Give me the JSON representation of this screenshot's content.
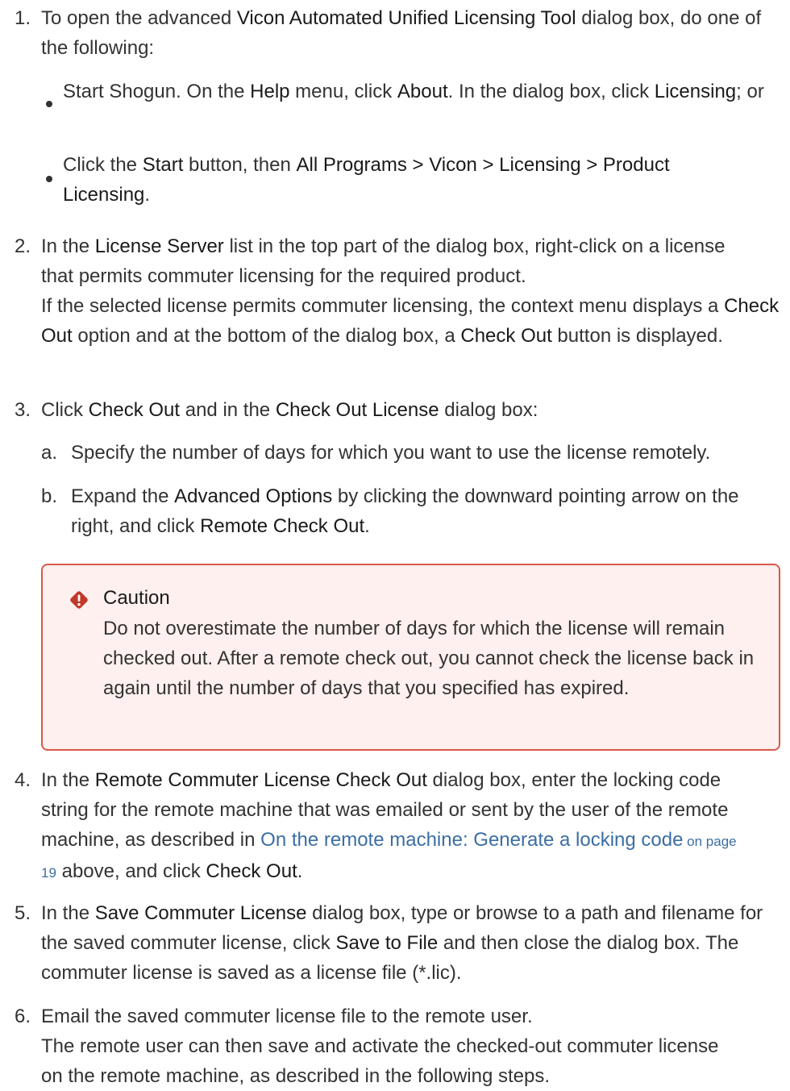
{
  "steps": {
    "s1": {
      "num": "1.",
      "t1": "To open the advanced ",
      "b1": "Vicon Automated Unified Licensing Tool",
      "t2": " dialog box, do one of the following:",
      "bullets": {
        "b1": {
          "t1": "Start Shogun. On the ",
          "u1": "Help",
          "t2": " menu, click ",
          "u2": "About",
          "t3": ". In the dialog box, click ",
          "u3": "Licensing",
          "t4": "; or"
        },
        "b2": {
          "t1": "Click the ",
          "u1": "Start",
          "t2": " button, then ",
          "u2": "All Programs > Vicon > Licensing > Product Licensing",
          "t3": "."
        }
      }
    },
    "s2": {
      "num": "2.",
      "t1": "In the ",
      "u1": "License Server",
      "t2": " list in the top part of the dialog box, right-click on a license that permits commuter licensing for the required product.",
      "t3": "If the selected license permits commuter licensing, the context menu displays a ",
      "u2": "Check Out",
      "t4": " option and at the bottom of the dialog box, a ",
      "u3": "Check Out",
      "t5": " button is displayed."
    },
    "s3": {
      "num": "3.",
      "t1": "Click ",
      "u1": "Check Out",
      "t2": " and in the ",
      "u2": "Check Out License",
      "t3": " dialog box:",
      "a": {
        "letter": "a.",
        "text": "Specify the number of days for which you want to use the license remotely."
      },
      "b": {
        "letter": "b.",
        "t1": "Expand the ",
        "u1": "Advanced Options",
        "t2": " by clicking the downward pointing arrow on the right, and click ",
        "u2": "Remote Check Out",
        "t3": "."
      }
    },
    "caution": {
      "title": "Caution",
      "text": "Do not overestimate the number of days for which the license will remain checked out. After a remote check out, you cannot check the license back in again until the number of days that you specified has expired.",
      "accent": "#d9584a",
      "background": "#fdf0ee"
    },
    "s4": {
      "num": "4.",
      "t1": "In the ",
      "u1": "Remote Commuter License Check Out",
      "t2": " dialog box, enter the locking code string for the remote machine that was emailed or sent by the user of the remote machine, as described in ",
      "link": "On the remote machine: Generate a locking code",
      "page_ref": " on page 19",
      "t3": " above, and click ",
      "u2": "Check Out",
      "t4": "."
    },
    "s5": {
      "num": "5.",
      "t1": "In the ",
      "u1": "Save Commuter License",
      "t2": " dialog box, type or browse to a path and filename for the saved commuter license, click ",
      "u2": "Save to File",
      "t3": " and then close the dialog box. The commuter license is saved as a license file (*.lic)."
    },
    "s6": {
      "num": "6.",
      "t1": "Email the saved commuter license file to the remote user.",
      "t2": "The remote user can then save and activate the checked-out commuter license on the remote machine, as described in the following steps."
    }
  },
  "colors": {
    "text": "#333333",
    "link": "#3b6ea5",
    "caution_border": "#d9584a",
    "caution_bg": "#fdf0ee"
  },
  "icons": {
    "caution": "caution-diamond-icon"
  }
}
